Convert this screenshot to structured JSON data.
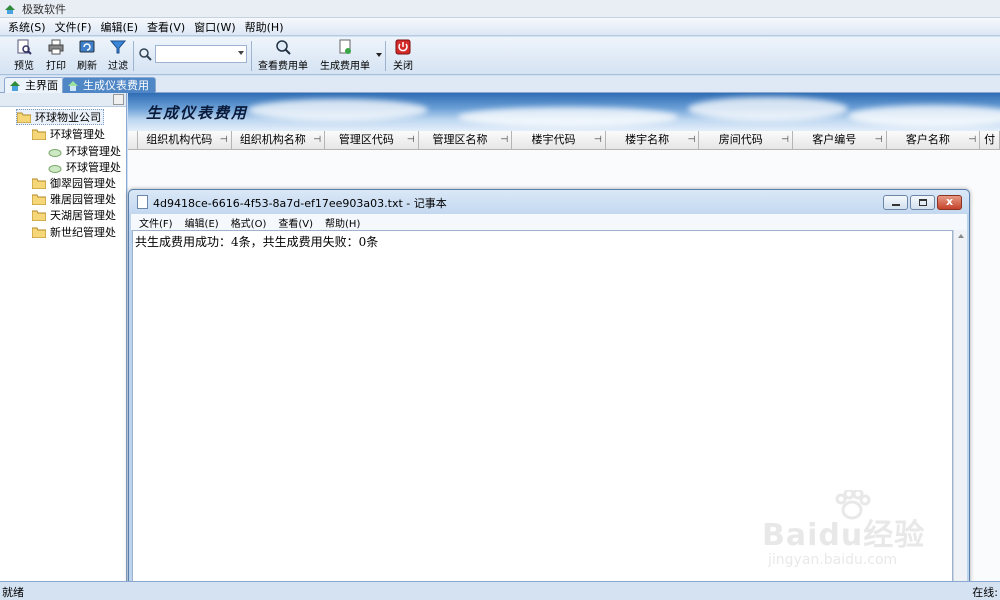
{
  "app": {
    "title": "极致软件"
  },
  "menubar": [
    "系统(S)",
    "文件(F)",
    "编辑(E)",
    "查看(V)",
    "窗口(W)",
    "帮助(H)"
  ],
  "toolbar": {
    "preview": "预览",
    "print": "打印",
    "refresh": "刷新",
    "filter": "过滤",
    "search_value": "",
    "view_bill": "查看费用单",
    "generate_bill": "生成费用单",
    "close": "关闭"
  },
  "tabs": [
    "主界面",
    "生成仪表费用"
  ],
  "tree": {
    "root": "环球物业公司",
    "nodes": [
      "环球管理处",
      "环球管理处",
      "环球管理处",
      "御翠园管理处",
      "雅居园管理处",
      "天湖居管理处",
      "新世纪管理处"
    ]
  },
  "main": {
    "banner_title": "生成仪表费用",
    "columns": [
      "组织机构代码",
      "组织机构名称",
      "管理区代码",
      "管理区名称",
      "楼宇代码",
      "楼宇名称",
      "房间代码",
      "客户编号",
      "客户名称",
      "付"
    ]
  },
  "notepad": {
    "caption": "4d9418ce-6616-4f53-8a7d-ef17ee903a03.txt - 记事本",
    "menu": [
      "文件(F)",
      "编辑(E)",
      "格式(O)",
      "查看(V)",
      "帮助(H)"
    ],
    "content": "共生成费用成功：4条，共生成费用失败：0条",
    "close_glyph": "x"
  },
  "status": {
    "left": "就绪",
    "right": "在线:"
  },
  "watermark": {
    "main": "Baidu经验",
    "sub": "jingyan.baidu.com"
  }
}
